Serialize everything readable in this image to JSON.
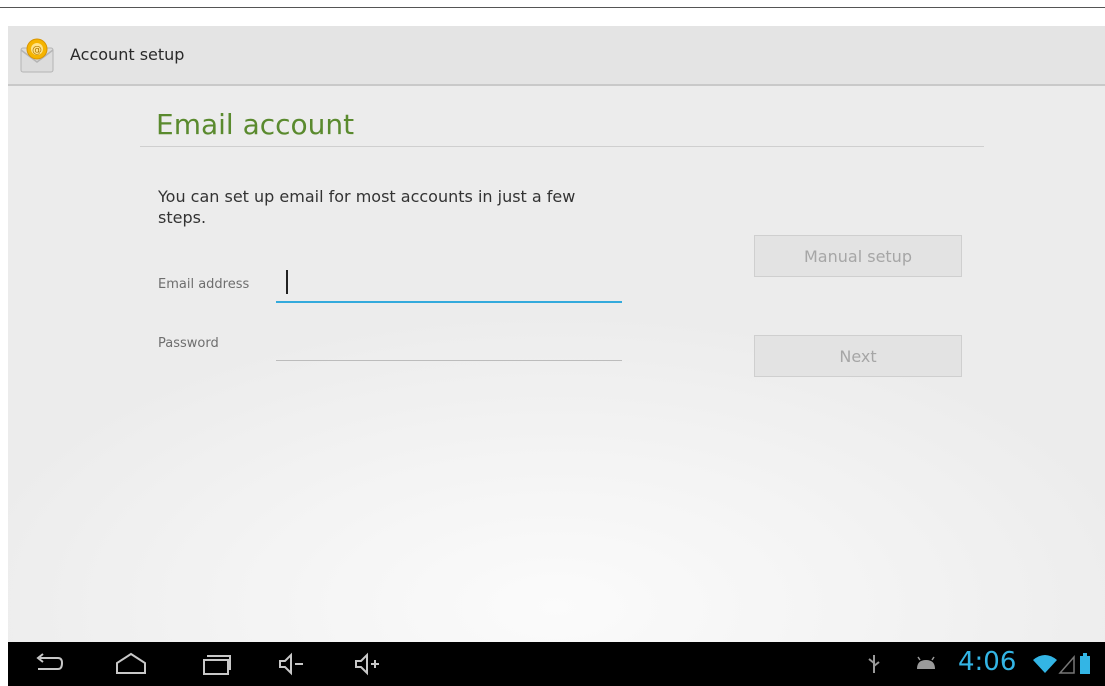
{
  "action_bar": {
    "title": "Account setup",
    "app_icon": "email-app-icon"
  },
  "content": {
    "heading": "Email account",
    "intro": "You can set up email for most accounts in just a few steps.",
    "email": {
      "label": "Email address",
      "value": ""
    },
    "password": {
      "label": "Password",
      "value": ""
    },
    "buttons": {
      "manual_setup": "Manual setup",
      "next": "Next"
    }
  },
  "system_bar": {
    "nav_icons": [
      "back-icon",
      "home-icon",
      "recent-apps-icon",
      "volume-down-icon",
      "volume-up-icon"
    ],
    "status_icons": [
      "usb-icon",
      "android-debug-icon",
      "wifi-icon",
      "signal-icon",
      "battery-icon"
    ],
    "time": "4:06"
  },
  "colors": {
    "accent": "#33aadc",
    "heading": "#5a8a2e",
    "status_time": "#33b5e5"
  }
}
